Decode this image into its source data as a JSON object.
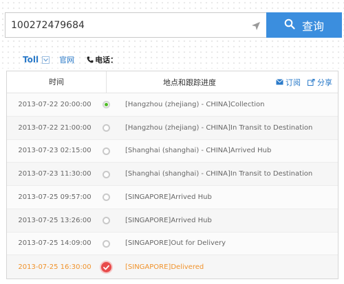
{
  "search": {
    "value": "100272479684",
    "button_label": "查询",
    "locate_icon": "locate-arrow-icon",
    "search_icon": "search-icon"
  },
  "carrier": {
    "name": "Toll",
    "official_site_label": "官网",
    "phone_label": "电话："
  },
  "table": {
    "col_time": "时间",
    "col_location": "地点和跟踪进度",
    "subscribe_label": "订阅",
    "share_label": "分享",
    "rows": [
      {
        "time": "2013-07-22 20:00:00",
        "status": "[Hangzhou (zhejiang) - CHINA]Collection"
      },
      {
        "time": "2013-07-22 21:00:00",
        "status": "[Hangzhou (zhejiang) - CHINA]In Transit to Destination"
      },
      {
        "time": "2013-07-23 02:15:00",
        "status": "[Shanghai (shanghai) - CHINA]Arrived Hub"
      },
      {
        "time": "2013-07-23 11:30:00",
        "status": "[Shanghai (shanghai) - CHINA]In Transit to Destination"
      },
      {
        "time": "2013-07-25 09:57:00",
        "status": "[SINGAPORE]Arrived Hub"
      },
      {
        "time": "2013-07-25 13:26:00",
        "status": "[SINGAPORE]Arrived Hub"
      },
      {
        "time": "2013-07-25 14:09:00",
        "status": "[SINGAPORE]Out for Delivery"
      },
      {
        "time": "2013-07-25 16:30:00",
        "status": "[SINGAPORE]Delivered"
      }
    ]
  },
  "colors": {
    "accent": "#3b8ede",
    "link": "#2a7ac9",
    "delivered": "#f0922b",
    "start_node": "#4dbb25",
    "end_node": "#e84a4a"
  }
}
